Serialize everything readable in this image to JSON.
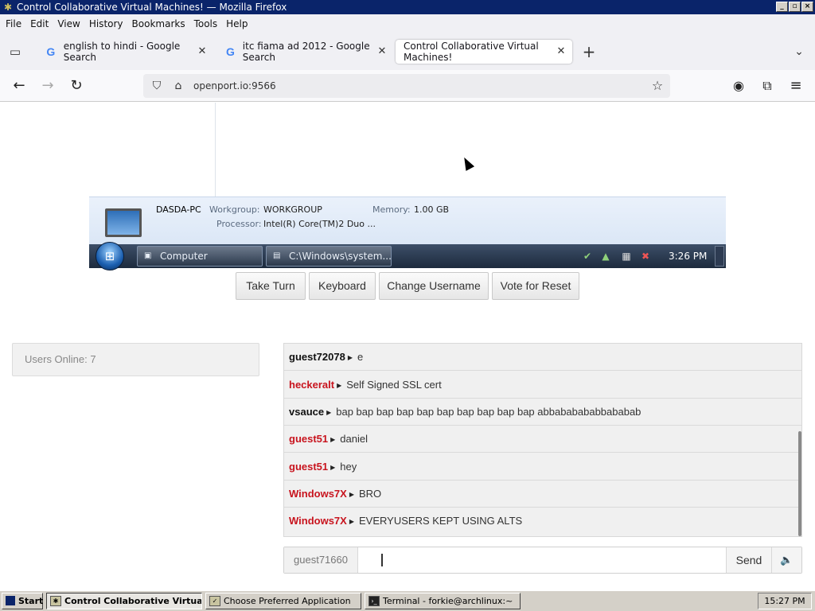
{
  "window": {
    "title": "Control Collaborative Virtual Machines! — Mozilla Firefox"
  },
  "menu": [
    "File",
    "Edit",
    "View",
    "History",
    "Bookmarks",
    "Tools",
    "Help"
  ],
  "tabs": [
    {
      "label": "english to hindi - Google Search",
      "favicon": "G"
    },
    {
      "label": "itc fiama ad 2012 - Google Search",
      "favicon": "G"
    },
    {
      "label": "Control Collaborative Virtual Machines!"
    }
  ],
  "nav": {
    "url": "openport.io:9566"
  },
  "vm": {
    "pc_name": "DASDA-PC",
    "workgroup_label": "Workgroup:",
    "workgroup_value": "WORKGROUP",
    "memory_label": "Memory:",
    "memory_value": "1.00 GB",
    "processor_label": "Processor:",
    "processor_value": "Intel(R) Core(TM)2 Duo ...",
    "taskbar_items": [
      "Computer",
      "C:\\Windows\\system..."
    ],
    "clock": "3:26 PM"
  },
  "controls": [
    "Take Turn",
    "Keyboard",
    "Change Username",
    "Vote for Reset"
  ],
  "users_online": "Users Online: 7",
  "chat": [
    {
      "user": "guest72078",
      "text": "e",
      "color": "#111111"
    },
    {
      "user": "heckeralt",
      "text": "Self Signed SSL cert",
      "color": "#c8141e"
    },
    {
      "user": "vsauce",
      "text": "bap bap bap bap bap bap bap bap bap bap abbababababbababab",
      "color": "#111111"
    },
    {
      "user": "guest51",
      "text": "daniel",
      "color": "#c8141e"
    },
    {
      "user": "guest51",
      "text": "hey",
      "color": "#c8141e"
    },
    {
      "user": "Windows7X",
      "text": "BRO",
      "color": "#c8141e"
    },
    {
      "user": "Windows7X",
      "text": "EVERYUSERS KEPT USING ALTS",
      "color": "#c8141e"
    }
  ],
  "input": {
    "nickname": "guest71660",
    "send_label": "Send",
    "sound_icon": "speaker-icon"
  },
  "os_taskbar": {
    "start": "Start",
    "items": [
      "Control Collaborative Virtua...",
      "Choose Preferred Application",
      "Terminal - forkie@archlinux:~"
    ],
    "clock": "15:27 PM"
  }
}
